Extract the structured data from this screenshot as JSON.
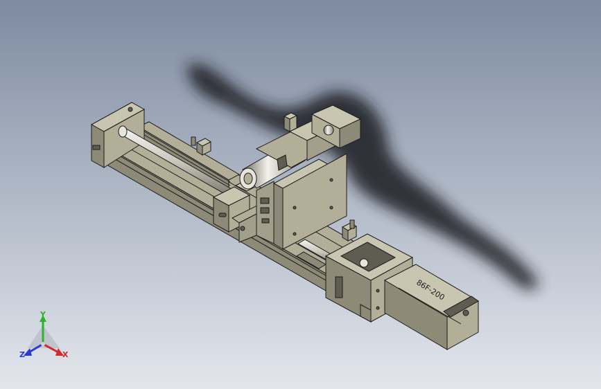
{
  "viewport": {
    "background_top": "#7d8ba1",
    "background_bottom": "#e3e6ec",
    "part_color": "#b2ae98",
    "part_shade": "#8d8a78",
    "part_dark": "#5f5d52",
    "edge_color": "#1c1c1c",
    "shadow_color": "#1a1d24"
  },
  "motor": {
    "label": "86F-200"
  },
  "triad": {
    "x_label": "X",
    "y_label": "Y",
    "z_label": "Z",
    "x_color": "#d42a2a",
    "y_color": "#2ab52a",
    "z_color": "#2a3ad4"
  }
}
